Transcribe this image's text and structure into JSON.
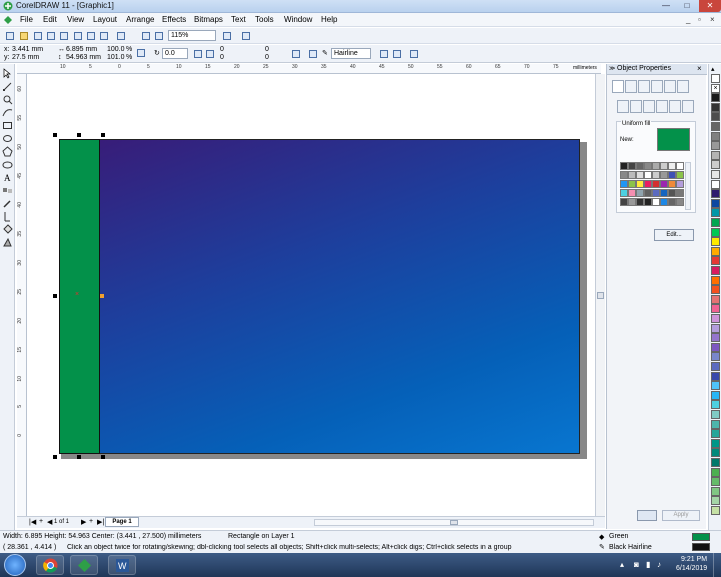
{
  "window": {
    "title": "CorelDRAW 11 - [Graphic1]",
    "controls": {
      "minimize": "—",
      "maximize": "□",
      "close": "✕"
    },
    "mdi_controls": {
      "minimize": "_",
      "restore": "▫",
      "close": "×"
    }
  },
  "menu": [
    "File",
    "Edit",
    "View",
    "Layout",
    "Arrange",
    "Effects",
    "Bitmaps",
    "Text",
    "Tools",
    "Window",
    "Help"
  ],
  "standard_toolbar": {
    "zoom_level": "115%"
  },
  "property_bar": {
    "x": "3.441 mm",
    "y": "27.5 mm",
    "width": "6.895 mm",
    "height": "54.963 mm",
    "scale_x": "100.0",
    "scale_y": "101.0",
    "percent": "%",
    "rotation": "0.0",
    "corner_1": "0",
    "corner_2": "0",
    "corner_3": "0",
    "corner_4": "0",
    "outline": "Hairline"
  },
  "ruler": {
    "unit": "millimeters",
    "h_ticks": [
      "10",
      "5",
      "0",
      "5",
      "10",
      "15",
      "20",
      "25",
      "30",
      "35",
      "40",
      "45",
      "50",
      "55",
      "60",
      "65",
      "70",
      "75"
    ],
    "v_ticks": [
      "60",
      "55",
      "50",
      "45",
      "40",
      "35",
      "30",
      "25",
      "20",
      "15",
      "10",
      "5",
      "0"
    ]
  },
  "page_nav": {
    "count": "1 of 1",
    "tab": "Page 1"
  },
  "docker": {
    "title": "Object Properties",
    "fill_label": "Uniform fill",
    "new_label": "New:",
    "new_color": "#03914a",
    "edit_button": "Edit...",
    "apply_button": "Apply",
    "swatches": [
      "#222222",
      "#444444",
      "#666666",
      "#888888",
      "#aaaaaa",
      "#cccccc",
      "#eeeeee",
      "#ffffff",
      "#888888",
      "#bbbbbb",
      "#dddddd",
      "#ffffff",
      "#cccccc",
      "#999999",
      "#3f51b5",
      "#8bc34a",
      "#2196f3",
      "#8bc34a",
      "#ffeb3b",
      "#e91e63",
      "#d32f2f",
      "#9c27b0",
      "#ef8a3a",
      "#b39ddb",
      "#4dd0e1",
      "#f48fb1",
      "#90a4ae",
      "#616161",
      "#5c6bc0",
      "#1565c0",
      "#555555",
      "#777777",
      "#444444",
      "#999999",
      "#333333",
      "#222222",
      "#ffffff",
      "#1e88e5",
      "#666666",
      "#888888"
    ]
  },
  "palette": [
    "#ffffff",
    "#000000",
    "#1a1a1a",
    "#333333",
    "#4d4d4d",
    "#666666",
    "#808080",
    "#999999",
    "#b3b3b3",
    "#cccccc",
    "#e6e6e6",
    "#ffffff",
    "#2e1a6e",
    "#0d47a1",
    "#0097a7",
    "#00a651",
    "#00c853",
    "#ffea00",
    "#ffab00",
    "#e53935",
    "#d81b60",
    "#ff6f00",
    "#f4511e",
    "#e57373",
    "#f06292",
    "#ce93d8",
    "#b39ddb",
    "#9575cd",
    "#7e57c2",
    "#7986cb",
    "#5c6bc0",
    "#3949ab",
    "#4fc3f7",
    "#29b6f6",
    "#4dd0e1",
    "#80cbc4",
    "#4db6ac",
    "#26a69a",
    "#009688",
    "#00897b",
    "#00796b",
    "#4caf50",
    "#66bb6a",
    "#81c784",
    "#a5d6a7",
    "#c5e1a5"
  ],
  "status": {
    "dims": "Width: 6.895  Height: 54.963  Center: (3.441 , 27.500)  millimeters",
    "object": "Rectangle on Layer 1",
    "coords": "( 28.361 , 4.414 )",
    "hint": "Click an object twice for rotating/skewing; dbl-clicking tool selects all objects; Shift+click multi-selects; Alt+click digs; Ctrl+click selects in a group",
    "fill_name": "Green",
    "fill_color": "#03914a",
    "outline_name": "Black  Hairline",
    "outline_color": "#111111"
  },
  "taskbar": {
    "time": "9:21 PM",
    "date": "6/14/2019"
  }
}
